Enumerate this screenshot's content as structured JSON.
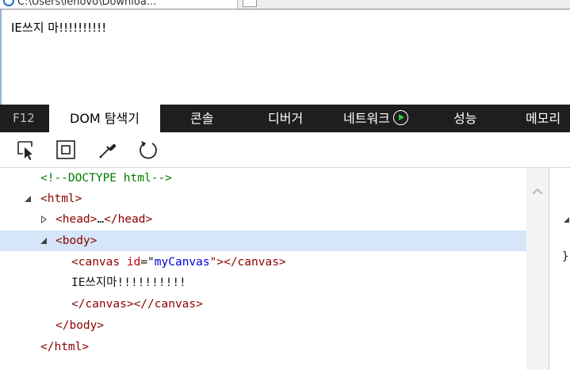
{
  "browser": {
    "tab_title": "C:\\Users\\lenovo\\Downloa..."
  },
  "page": {
    "text": "IE쓰지 마!!!!!!!!!!"
  },
  "devtools": {
    "tabs": {
      "f12": "F12",
      "dom_explorer": "DOM 탐색기",
      "console": "콘솔",
      "debugger": "디버거",
      "network": "네트워크",
      "performance": "성능",
      "memory": "메모리"
    },
    "toolbar": {
      "icons": [
        "select-element-icon",
        "highlight-box-icon",
        "eyedropper-icon",
        "refresh-icon"
      ]
    },
    "tree": {
      "doctype": "<!--DOCTYPE html-->",
      "html_open": "<html>",
      "head_open": "<head>",
      "head_ellipsis": "…",
      "head_close": "</head>",
      "body_open": "<body>",
      "canvas_open_lt": "<canvas",
      "canvas_attr_name": " id",
      "canvas_attr_eq": "=\"",
      "canvas_attr_value": "myCanvas",
      "canvas_attr_end": "\">",
      "canvas_close": "</canvas>",
      "canvas_text": "IE쓰지마!!!!!!!!!!",
      "canvas_stray_close": "</canvas><//canvas>",
      "body_close": "</body>",
      "html_close": "</html>"
    },
    "styles_pane": {
      "brace": "}"
    }
  }
}
